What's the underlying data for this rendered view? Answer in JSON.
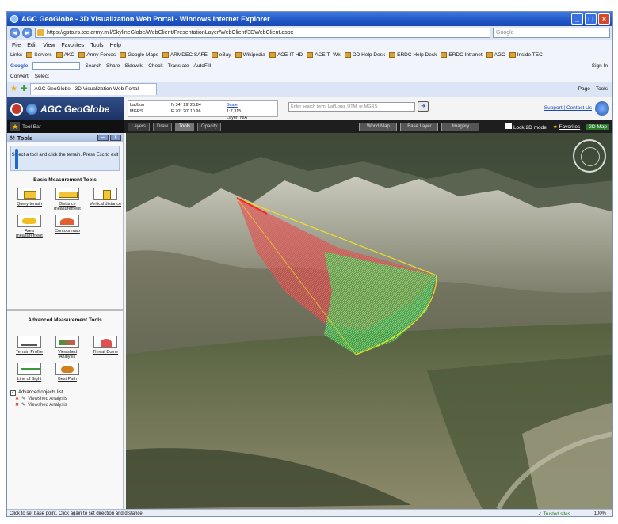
{
  "window": {
    "title": "AGC GeoGlobe - 3D Visualization Web Portal - Windows Internet Explorer"
  },
  "address": {
    "url": "https://gsto.rs.tec.army.mil/SkylineGlobe/WebClient/PresentationLayer/WebClient/3DWebClient.aspx",
    "search_placeholder": "Google"
  },
  "menu": [
    "File",
    "Edit",
    "View",
    "Favorites",
    "Tools",
    "Help"
  ],
  "links": {
    "label": "Links",
    "items": [
      "Servers",
      "AKO",
      "Army Forces",
      "Google Maps",
      "ARMDEC SAFE",
      "eBay",
      "Wikipedia",
      "ACE-IT HD",
      "ACEIT -Wk",
      "OD Help Desk",
      "ERDC Help Desk",
      "ERDC Intranet",
      "AGC",
      "Inside TEC"
    ]
  },
  "google_toolbar": {
    "label": "Google",
    "items": [
      "Search",
      "Share",
      "Sidewiki",
      "Check",
      "Translate",
      "AutoFill"
    ],
    "sign_in": "Sign In"
  },
  "convert_bar": [
    "Convert",
    "Select"
  ],
  "tab": {
    "label": "AGC GeoGlobe - 3D Visualization Web Portal",
    "right_tools": [
      "Page",
      "Tools"
    ]
  },
  "portal": {
    "brand": "AGC GeoGlobe",
    "coords": {
      "lat_label": "Lat/Lon",
      "lat_value": "N 34° 29' 25.84",
      "lon_value": "E 70° 20' 10.96",
      "mgrs_label": "MGRS",
      "scale_label": "Scale",
      "scale_value": "1:7,315",
      "layer_label": "Layer: N/A"
    },
    "search_placeholder": "Enter search term, Lat/Long, UTM, or MGRS",
    "support_links": "Support | Contact Us"
  },
  "darkbar": {
    "title": "Tool Bar",
    "tabs": [
      "Layers",
      "Draw",
      "Tools",
      "Opacity"
    ],
    "active_tab": "Tools",
    "buttons": [
      "World Map",
      "Base Layer",
      "Imagery"
    ],
    "lock_label": "Lock 2D mode",
    "favorites_label": "Favorites",
    "map2d_label": "2D Map"
  },
  "tools_panel": {
    "title": "Tools",
    "hint": "Select a tool and click the terrain. Press Esc to exit",
    "basic_title": "Basic Measurement Tools",
    "basic_tools": [
      {
        "label": "Query terrain",
        "icon": "query-terrain-icon",
        "cls": "yellow"
      },
      {
        "label": "Distance measurement",
        "icon": "ruler-icon",
        "cls": "ruler"
      },
      {
        "label": "Vertical distance",
        "icon": "vertical-distance-icon",
        "cls": "vert"
      },
      {
        "label": "Area measurement",
        "icon": "area-icon",
        "cls": "area"
      },
      {
        "label": "Contour map",
        "icon": "contour-icon",
        "cls": "contour"
      }
    ],
    "advanced_title": "Advanced Measurement Tools",
    "advanced_tools": [
      {
        "label": "Terrain Profile",
        "icon": "terrain-profile-icon",
        "cls": "profile"
      },
      {
        "label": "Viewshed Analysis",
        "icon": "viewshed-icon",
        "cls": "viewshed"
      },
      {
        "label": "Threat Dome",
        "icon": "threat-dome-icon",
        "cls": "threat"
      },
      {
        "label": "Line of Sight",
        "icon": "line-of-sight-icon",
        "cls": "los"
      },
      {
        "label": "Best Path",
        "icon": "best-path-icon",
        "cls": "best"
      }
    ],
    "objects_title": "Advanced objects list",
    "objects": [
      "Viewshed Analysis",
      "Viewshed Analysis"
    ]
  },
  "status": {
    "message": "Click to set base point. Click again to set direction and distance.",
    "zone": "Trusted sites",
    "zoom": "100%"
  }
}
